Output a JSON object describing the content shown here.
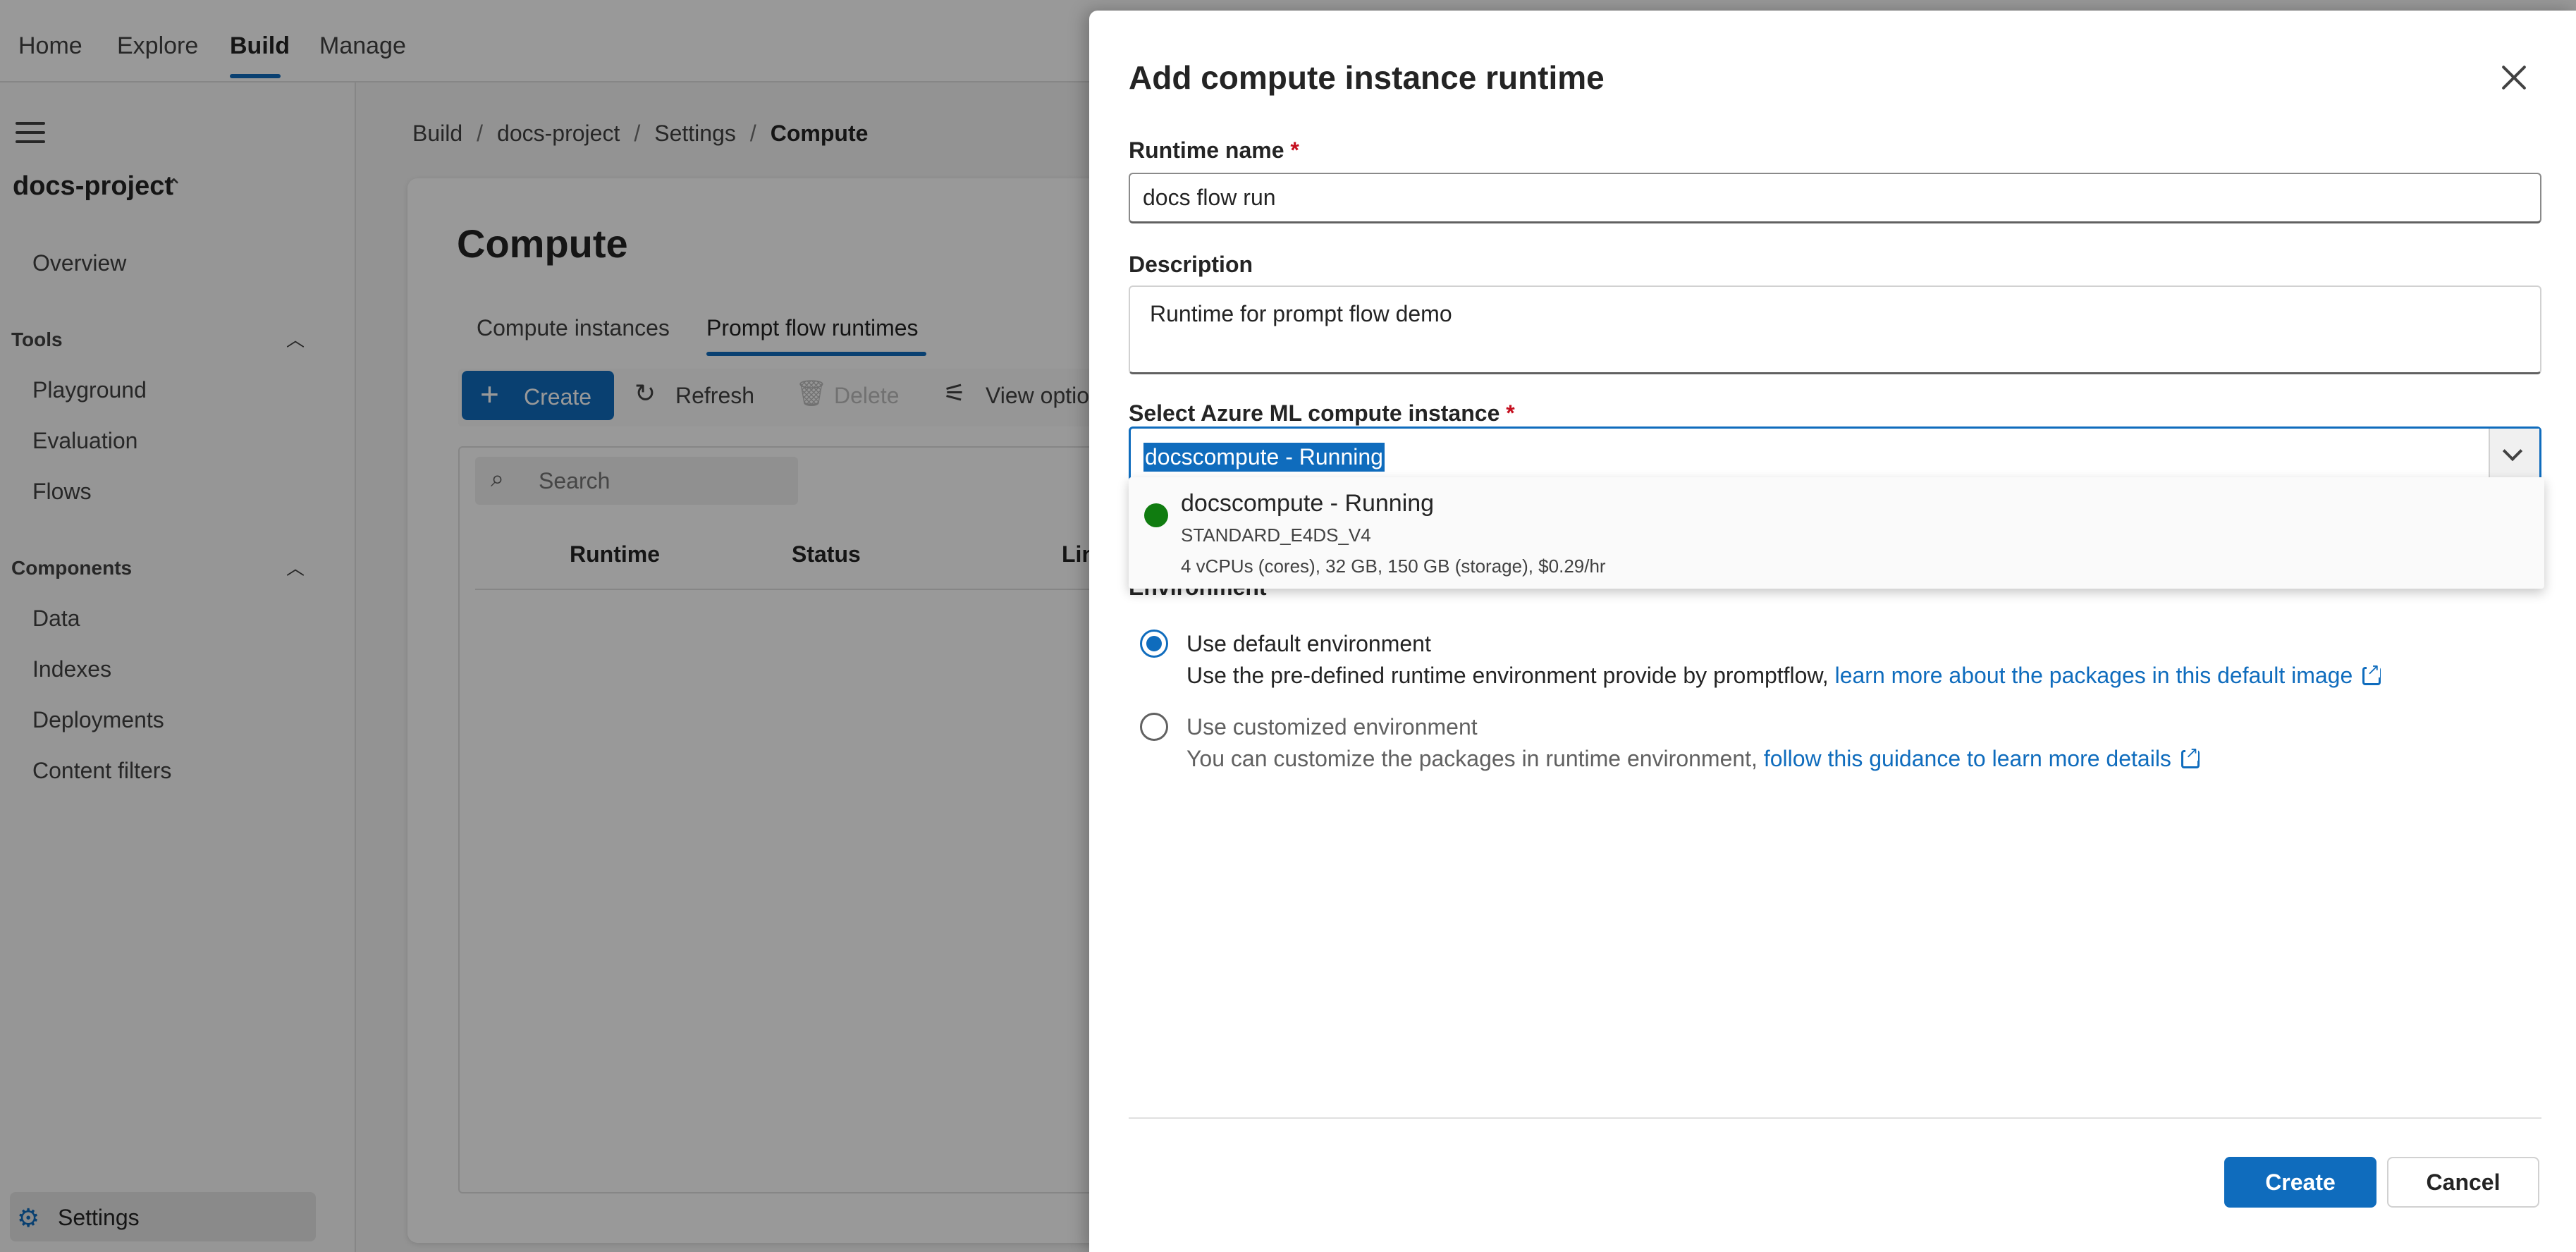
{
  "topnav": {
    "items": [
      "Home",
      "Explore",
      "Build",
      "Manage"
    ],
    "active": "Build"
  },
  "sidebar": {
    "project_name": "docs-project",
    "overview": "Overview",
    "tools_group": "Tools",
    "tools": [
      "Playground",
      "Evaluation",
      "Flows"
    ],
    "components_group": "Components",
    "components": [
      "Data",
      "Indexes",
      "Deployments",
      "Content filters"
    ],
    "settings": "Settings"
  },
  "breadcrumb": [
    "Build",
    "docs-project",
    "Settings",
    "Compute"
  ],
  "main": {
    "title": "Compute",
    "tabs": [
      "Compute instances",
      "Prompt flow runtimes"
    ],
    "toolbar": {
      "create": "Create",
      "refresh": "Refresh",
      "delete": "Delete",
      "view_options": "View optio"
    },
    "search_placeholder": "Search",
    "columns": [
      "Runtime",
      "Status",
      "Lin"
    ]
  },
  "panel": {
    "title": "Add compute instance runtime",
    "runtime_name_label": "Runtime name",
    "runtime_name_value": "docs flow run",
    "description_label": "Description",
    "description_value": "Runtime for prompt flow demo",
    "compute_label": "Select Azure ML compute instance",
    "compute_selected": "docscompute - Running",
    "dropdown_option": {
      "title": "docscompute - Running",
      "sku": "STANDARD_E4DS_V4",
      "specs": "4 vCPUs (cores), 32 GB, 150 GB (storage), $0.29/hr",
      "status_color": "#107c10"
    },
    "environment_label": "Environment",
    "env_default_label": "Use default environment",
    "env_default_desc": "Use the pre-defined runtime environment provide by promptflow,",
    "env_default_link": "learn more about the packages in this default image",
    "env_custom_label": "Use customized environment",
    "env_custom_desc": "You can customize the packages in runtime environment,",
    "env_custom_link": "follow this guidance to learn more details",
    "create_button": "Create",
    "cancel_button": "Cancel"
  },
  "colors": {
    "accent": "#0f6cbd",
    "required": "#c50f1f",
    "running": "#107c10"
  }
}
